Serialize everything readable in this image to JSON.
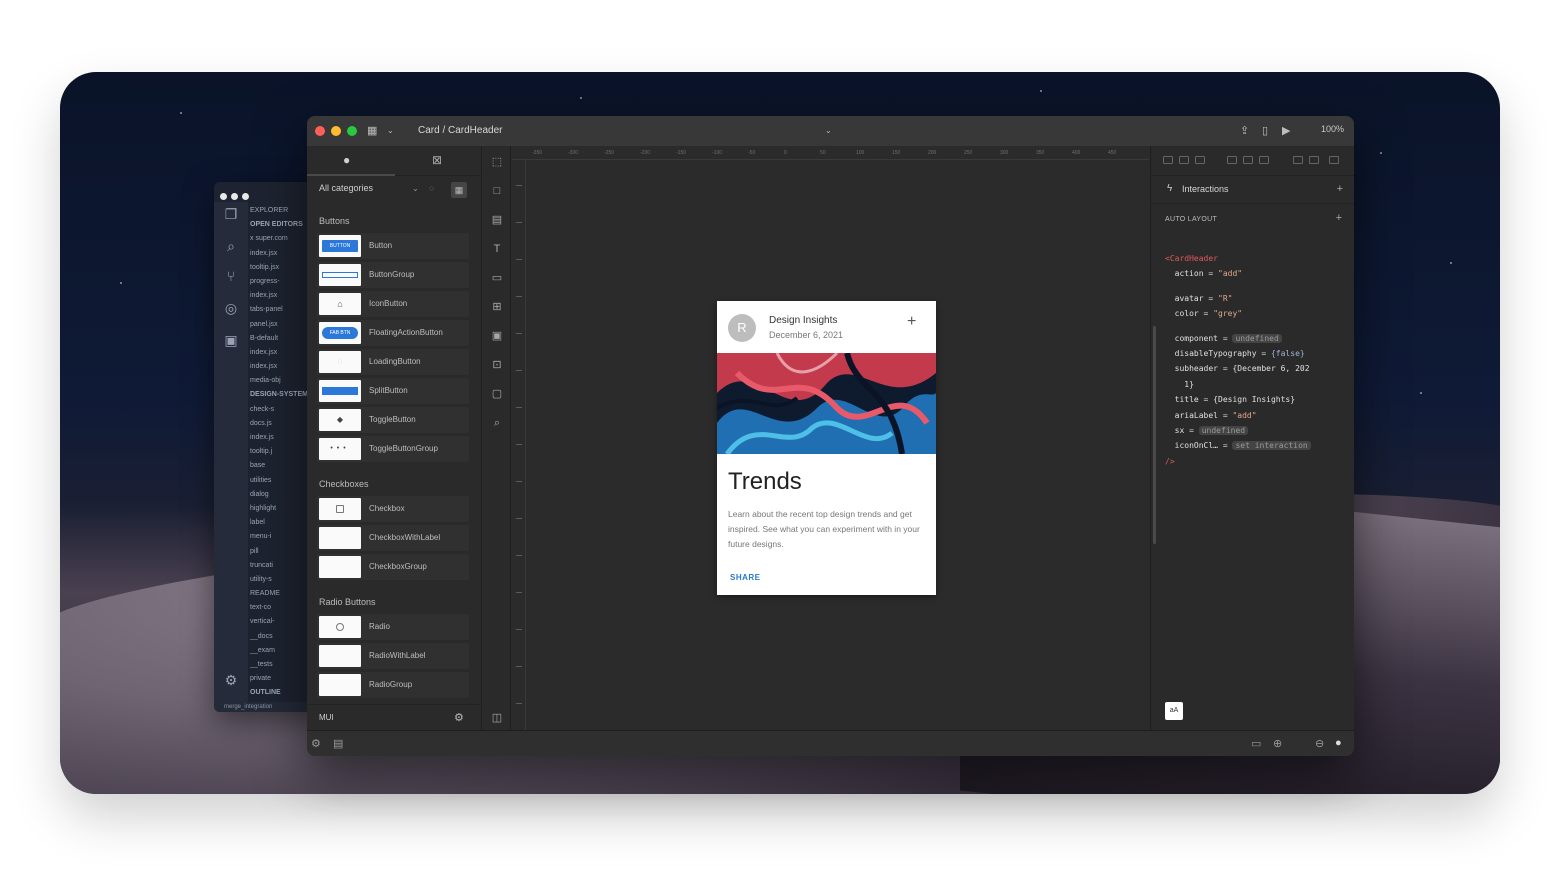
{
  "window": {
    "breadcrumb": "Card / CardHeader",
    "zoom": "100%"
  },
  "palette": {
    "filter": "All categories",
    "sections": [
      {
        "title": "Buttons",
        "items": [
          "Button",
          "ButtonGroup",
          "IconButton",
          "FloatingActionButton",
          "LoadingButton",
          "SplitButton",
          "ToggleButton",
          "ToggleButtonGroup"
        ]
      },
      {
        "title": "Checkboxes",
        "items": [
          "Checkbox",
          "CheckboxWithLabel",
          "CheckboxGroup"
        ]
      },
      {
        "title": "Radio Buttons",
        "items": [
          "Radio",
          "RadioWithLabel",
          "RadioGroup"
        ]
      }
    ],
    "thumb_texts": {
      "button": "BUTTON",
      "fab": "FAB BTN"
    },
    "footer": "MUI"
  },
  "card": {
    "avatar": "R",
    "title": "Design Insights",
    "subheader": "December 6, 2021",
    "heading": "Trends",
    "body": "Learn about the recent top design trends and get inspired. See what you can experiment with in your future designs.",
    "action": "SHARE"
  },
  "inspector": {
    "interactions": "Interactions",
    "auto_layout": "AUTO LAYOUT",
    "code": {
      "tag": "<CardHeader",
      "action_key": "action",
      "action_val": "\"add\"",
      "avatar_key": "avatar",
      "avatar_val": "\"R\"",
      "color_key": "color",
      "color_val": "\"grey\"",
      "component_key": "component",
      "component_val": "undefined",
      "disableTypography_key": "disableTypography",
      "disableTypography_val": "{false}",
      "subheader_key": "subheader",
      "subheader_val": "{December 6, 202",
      "subheader_cont": "1}",
      "title_key": "title",
      "title_val": "{Design Insights}",
      "ariaLabel_key": "ariaLabel",
      "ariaLabel_val": "\"add\"",
      "sx_key": "sx",
      "sx_val": "undefined",
      "iconOnCl_key": "iconOnCl…",
      "iconOnCl_val": "set interaction",
      "close": "/>"
    },
    "swatch": "aA"
  },
  "vscode": {
    "explorer": "EXPLORER",
    "open_editors": "OPEN EDITORS",
    "files": [
      "x super.com",
      "index.jsx",
      "tooltip.jsx",
      "progress-",
      "index.jsx",
      "tabs-panel",
      "panel.jsx",
      "B-default",
      "index.jsx",
      "index.jsx",
      "media-obj"
    ],
    "design_system": "DESIGN-SYSTEM",
    "tree2": [
      "check-s",
      "docs.js",
      "index.js",
      "tooltip.j",
      "base",
      "utilities",
      "dialog",
      "highlight",
      "label",
      "menu-i",
      "pill",
      "truncati",
      "utility-s",
      "README",
      "text-co",
      "vertical-",
      "__docs",
      "__exam",
      "__tests",
      "private"
    ],
    "outline": "OUTLINE",
    "branch": "merge_integration"
  }
}
